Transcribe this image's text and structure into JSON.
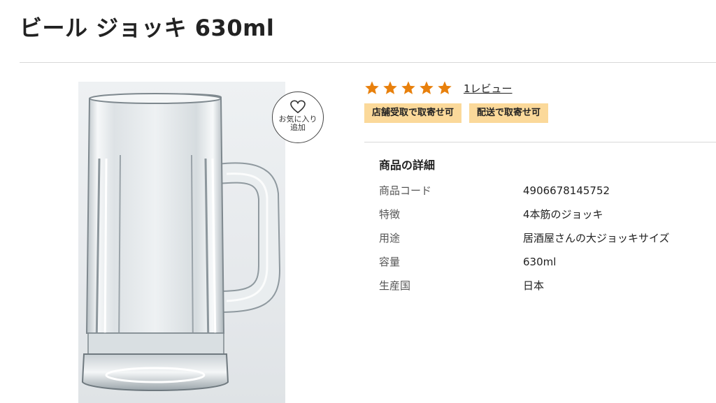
{
  "product": {
    "title": "ビール ジョッキ 630ml"
  },
  "favorite": {
    "label": "お気に入り追加",
    "icon": "heart-outline-icon"
  },
  "rating": {
    "stars": 5,
    "max_stars": 5,
    "star_color": "#e8800c",
    "review_link": "1レビュー"
  },
  "tags": [
    {
      "label": "店舗受取で取寄せ可"
    },
    {
      "label": "配送で取寄せ可"
    }
  ],
  "tag_color": "#fbd99a",
  "details": {
    "heading": "商品の詳細",
    "rows": [
      {
        "key": "商品コード",
        "value": "4906678145752"
      },
      {
        "key": "特徴",
        "value": "4本筋のジョッキ"
      },
      {
        "key": "用途",
        "value": "居酒屋さんの大ジョッキサイズ"
      },
      {
        "key": "容量",
        "value": "630ml"
      },
      {
        "key": "生産国",
        "value": "日本"
      }
    ]
  }
}
